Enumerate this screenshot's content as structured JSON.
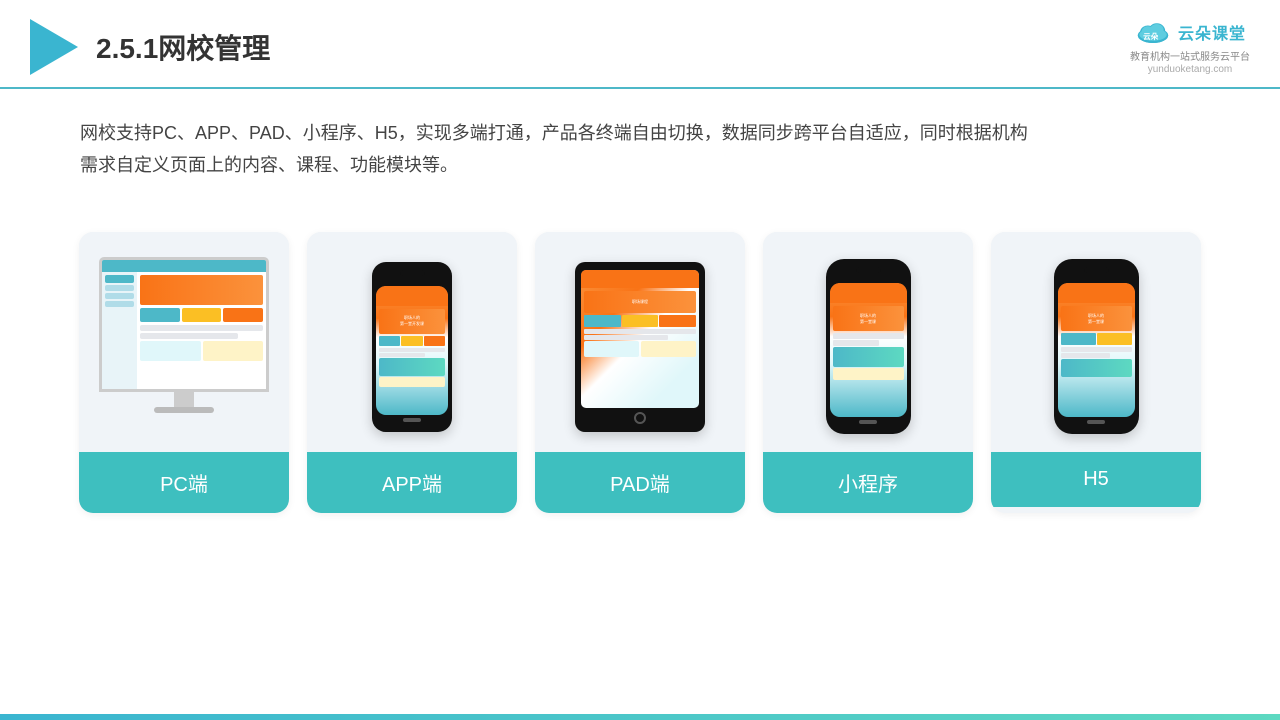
{
  "header": {
    "title_prefix": "2.5.1",
    "title_main": "网校管理",
    "brand_name": "云朵课堂",
    "brand_url": "yunduoketang.com",
    "brand_tagline": "教育机构一站\n式服务云平台"
  },
  "description": {
    "text": "网校支持PC、APP、PAD、小程序、H5，实现多端打通，产品各终端自由切换，数据同步跨平台自适应，同时根据机构",
    "text2": "需求自定义页面上的内容、课程、功能模块等。"
  },
  "cards": [
    {
      "id": "pc",
      "label": "PC端"
    },
    {
      "id": "app",
      "label": "APP端"
    },
    {
      "id": "pad",
      "label": "PAD端"
    },
    {
      "id": "mini",
      "label": "小程序"
    },
    {
      "id": "h5",
      "label": "H5"
    }
  ]
}
